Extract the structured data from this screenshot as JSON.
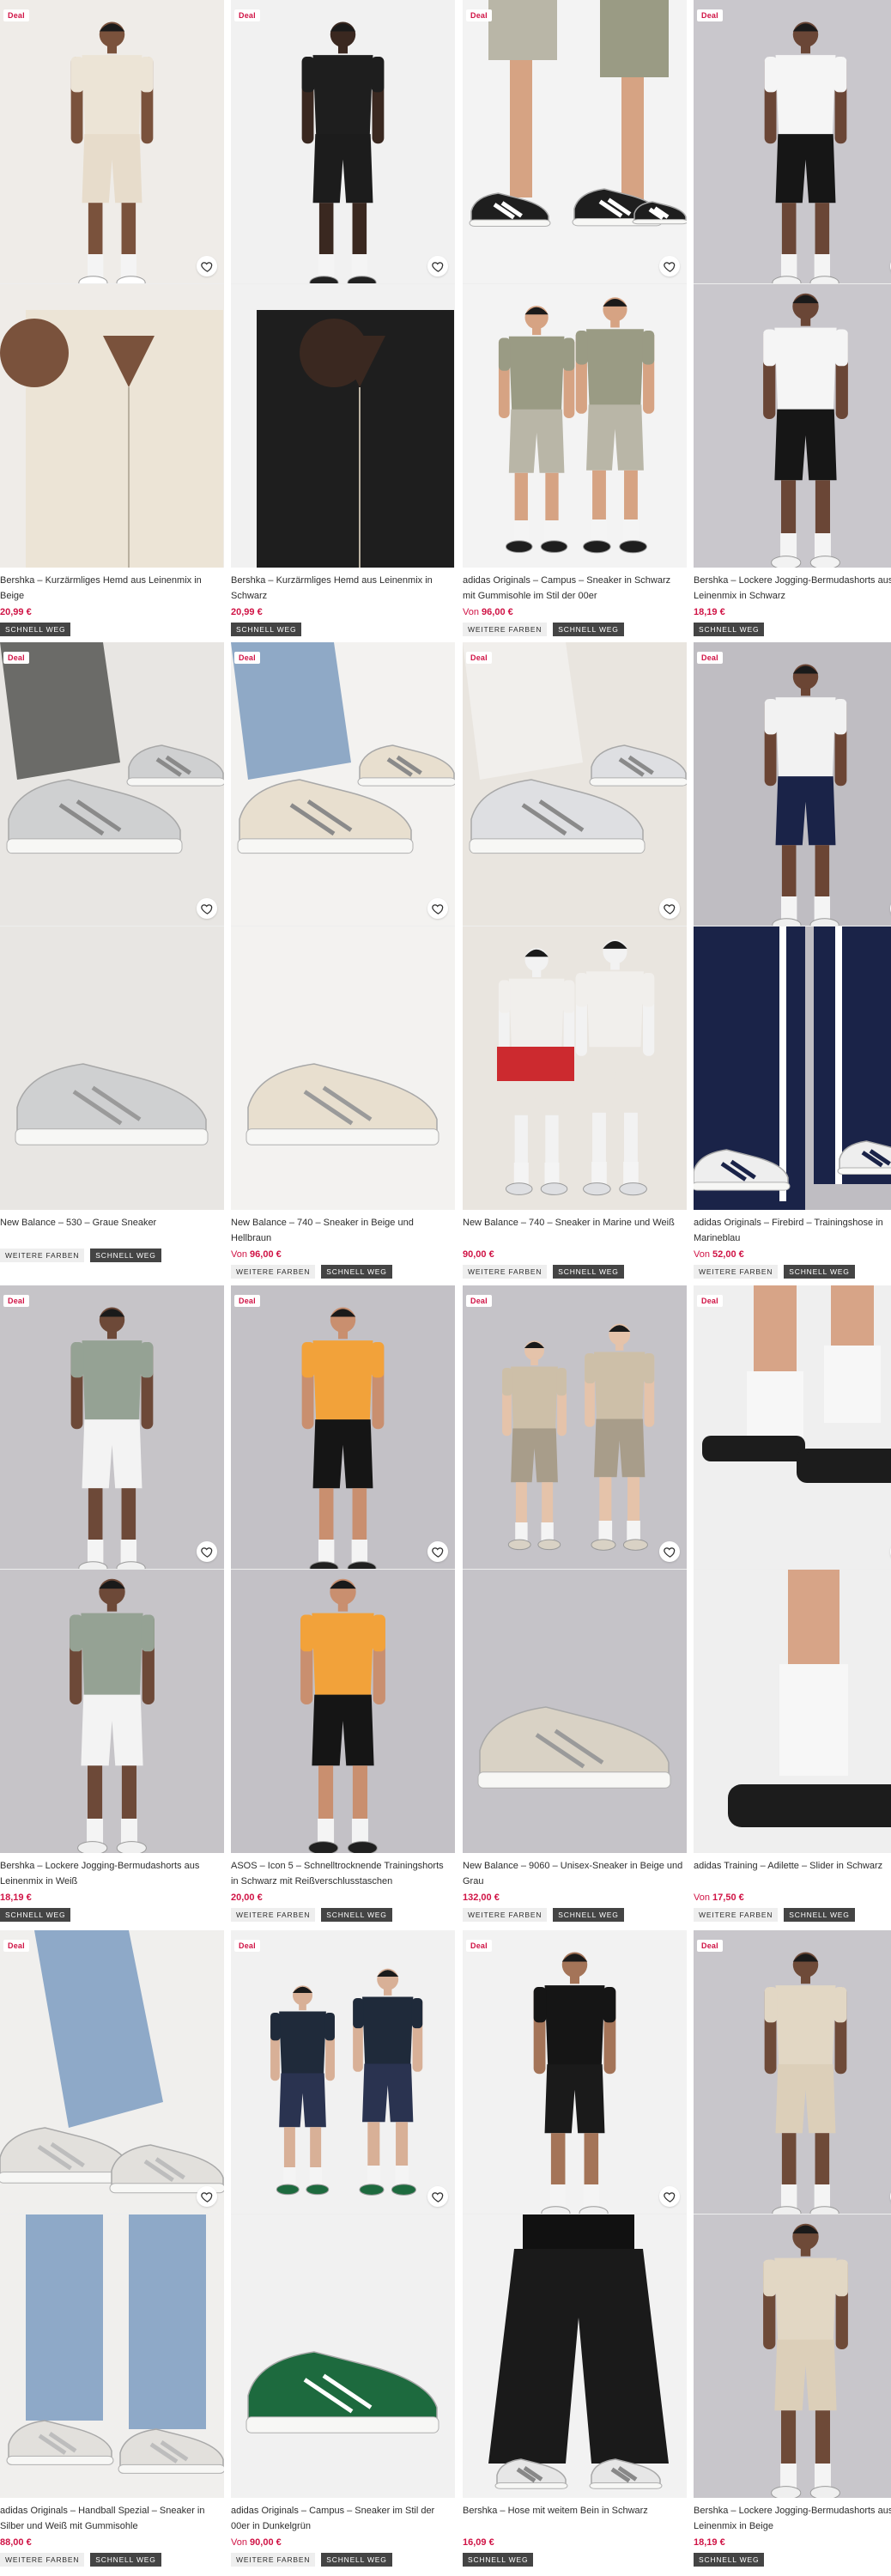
{
  "products": [
    {
      "deal": "Deal",
      "title": "Bershka – Kurzärmliges Hemd aus Leinenmix in Beige",
      "price": "20,99 €",
      "price_prefix": "",
      "badges": [
        "SCHNELL WEG"
      ],
      "bg": "#efece8",
      "figure": "person",
      "top": "#ece4d6",
      "bottom": "#e7dccb",
      "skin": "#7a523c",
      "shoe": "#ffffff",
      "closeup": "shirt-beige"
    },
    {
      "deal": "Deal",
      "title": "Bershka – Kurzärmliges Hemd aus Leinenmix in Schwarz",
      "price": "20,99 €",
      "price_prefix": "",
      "badges": [
        "SCHNELL WEG"
      ],
      "bg": "#f1f1f1",
      "figure": "person",
      "top": "#1e1e1e",
      "bottom": "#1c1c1c",
      "skin": "#3a2820",
      "shoe": "#222222",
      "closeup": "shirt-black"
    },
    {
      "deal": "Deal",
      "title": "adidas Originals – Campus – Sneaker in Schwarz mit Gummisohle im Stil der 00er",
      "price": "96,00 €",
      "price_prefix": "Von ",
      "badges": [
        "WEITERE FARBEN",
        "SCHNELL WEG"
      ],
      "bg": "#f3f3f3",
      "figure": "legs",
      "top": "#9a9b84",
      "bottom": "#b9b6a7",
      "skin": "#d6a383",
      "shoe": "#1e1e1e",
      "closeup": "couple"
    },
    {
      "deal": "Deal",
      "title": "Bershka – Lockere Jogging-Bermudashorts aus Leinenmix in Schwarz",
      "price": "18,19 €",
      "price_prefix": "",
      "badges": [
        "SCHNELL WEG"
      ],
      "bg": "#c9c7cc",
      "figure": "person",
      "top": "#f5f5f5",
      "bottom": "#161616",
      "skin": "#6a4636",
      "shoe": "#f2f2f2",
      "closeup": "person-white-black"
    },
    {
      "deal": "Deal",
      "title": "New Balance – 530 – Graue Sneaker",
      "price": "",
      "price_prefix": "",
      "badges": [
        "WEITERE FARBEN",
        "SCHNELL WEG"
      ],
      "bg": "#e8e6e3",
      "figure": "sneaker",
      "top": "#6b6b68",
      "bottom": "#8c8b88",
      "skin": "#dcdcdc",
      "shoe": "#cfd0d1",
      "closeup": "sneaker-grey"
    },
    {
      "deal": "Deal",
      "title": "New Balance – 740 – Sneaker in Beige und Hellbraun",
      "price": "96,00 €",
      "price_prefix": "Von ",
      "badges": [
        "WEITERE FARBEN",
        "SCHNELL WEG"
      ],
      "bg": "#f3f2f0",
      "figure": "sneaker",
      "top": "#8fa9c6",
      "bottom": "#b4c6d9",
      "skin": "#ece4d8",
      "shoe": "#e8dfcf",
      "closeup": "sneaker-beige"
    },
    {
      "deal": "Deal",
      "title": "New Balance – 740 – Sneaker in Marine und Weiß",
      "price": "90,00 €",
      "price_prefix": "",
      "badges": [
        "WEITERE FARBEN",
        "SCHNELL WEG"
      ],
      "bg": "#e9e5df",
      "figure": "sneaker",
      "top": "#f1efec",
      "bottom": "#e9e5df",
      "skin": "#f2f2f2",
      "shoe": "#dedfe2",
      "closeup": "couple-red"
    },
    {
      "deal": "Deal",
      "title": "adidas Originals – Firebird – Trainingshose in Marineblau",
      "price": "52,00 €",
      "price_prefix": "Von ",
      "badges": [
        "WEITERE FARBEN",
        "SCHNELL WEG"
      ],
      "bg": "#bfbdc2",
      "figure": "person",
      "top": "#f2f2f2",
      "bottom": "#1a2348",
      "skin": "#6b4534",
      "shoe": "#eeeeee",
      "closeup": "trackpants"
    },
    {
      "deal": "Deal",
      "title": "Bershka – Lockere Jogging-Bermudashorts aus Leinenmix in Weiß",
      "price": "18,19 €",
      "price_prefix": "",
      "badges": [
        "SCHNELL WEG"
      ],
      "bg": "#c6c4c8",
      "figure": "person",
      "top": "#95a294",
      "bottom": "#f3f3f3",
      "skin": "#6d4938",
      "shoe": "#f0f0f0",
      "closeup": "person-green-white"
    },
    {
      "deal": "Deal",
      "title": "ASOS – Icon 5 – Schnelltrocknende Trainingshorts in Schwarz mit Reißverschlusstaschen",
      "price": "20,00 €",
      "price_prefix": "",
      "badges": [
        "WEITERE FARBEN",
        "SCHNELL WEG"
      ],
      "bg": "#c3c1c6",
      "figure": "kneel",
      "top": "#f2a23a",
      "bottom": "#151515",
      "skin": "#c98f6f",
      "shoe": "#202020",
      "closeup": "person-orange"
    },
    {
      "deal": "Deal",
      "title": "New Balance – 9060 – Unisex-Sneaker in Beige und Grau",
      "price": "132,00 €",
      "price_prefix": "",
      "badges": [
        "WEITERE FARBEN",
        "SCHNELL WEG"
      ],
      "bg": "#c5c3c8",
      "figure": "couple",
      "top": "#cdbfa8",
      "bottom": "#a89d8a",
      "skin": "#e5c3aa",
      "shoe": "#d9d2c5",
      "closeup": "sneaker-9060"
    },
    {
      "deal": "Deal",
      "title": "adidas Training – Adilette – Slider in Schwarz",
      "price": "17,50 €",
      "price_prefix": "Von ",
      "badges": [
        "WEITERE FARBEN",
        "SCHNELL WEG"
      ],
      "bg": "#efefef",
      "figure": "slides",
      "top": "#f7f7f7",
      "bottom": "#e0b699",
      "skin": "#d7a487",
      "shoe": "#1c1c1c",
      "closeup": "slides-close"
    },
    {
      "deal": "Deal",
      "title": "adidas Originals – Handball Spezial – Sneaker in Silber und Weiß mit Gummisohle",
      "price": "88,00 €",
      "price_prefix": "",
      "badges": [
        "WEITERE FARBEN",
        "SCHNELL WEG"
      ],
      "bg": "#f0efed",
      "figure": "jeans-shoe",
      "top": "#8ea9c8",
      "bottom": "#7b98bb",
      "skin": "#f1eee9",
      "shoe": "#e2e0dc",
      "closeup": "jeans-shoe-2"
    },
    {
      "deal": "Deal",
      "title": "adidas Originals – Campus – Sneaker im Stil der 00er in Dunkelgrün",
      "price": "90,00 €",
      "price_prefix": "Von ",
      "badges": [
        "WEITERE FARBEN",
        "SCHNELL WEG"
      ],
      "bg": "#f1f1f1",
      "figure": "couple-sit",
      "top": "#1f2a3a",
      "bottom": "#2a3350",
      "skin": "#d8b097",
      "shoe": "#1d6a3e",
      "closeup": "green-sneaker"
    },
    {
      "deal": "Deal",
      "title": "Bershka – Hose mit weitem Bein in Schwarz",
      "price": "16,09 €",
      "price_prefix": "",
      "badges": [
        "SCHNELL WEG"
      ],
      "bg": "#f2f2f2",
      "figure": "person",
      "top": "#151515",
      "bottom": "#1a1a1a",
      "skin": "#a47458",
      "shoe": "#f0f0f0",
      "closeup": "black-pants"
    },
    {
      "deal": "Deal",
      "title": "Bershka – Lockere Jogging-Bermudashorts aus Leinenmix in Beige",
      "price": "18,19 €",
      "price_prefix": "",
      "badges": [
        "SCHNELL WEG"
      ],
      "bg": "#c8c6cb",
      "figure": "person",
      "top": "#e2d7c4",
      "bottom": "#dccfb9",
      "skin": "#6e4a38",
      "shoe": "#efefef",
      "closeup": "person-beige"
    }
  ]
}
